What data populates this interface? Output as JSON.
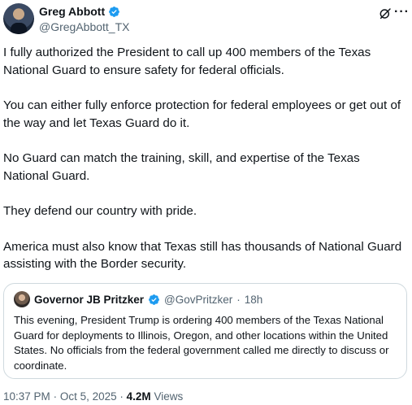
{
  "author": {
    "display_name": "Greg Abbott",
    "handle": "@GregAbbott_TX",
    "verified_icon": "verified-badge-icon"
  },
  "actions": {
    "grok_icon": "grok-icon",
    "more_label": "···"
  },
  "body": {
    "paragraphs": [
      "I fully authorized the President to call up 400 members of the Texas National Guard to ensure safety for federal officials.",
      "You can either fully enforce protection for federal employees or get out of the way and let Texas Guard do it.",
      "No Guard can match the training, skill, and expertise of the Texas National Guard.",
      "They defend our country with pride.",
      "America must also know that Texas still has thousands of National Guard assisting with the Border security."
    ]
  },
  "quote": {
    "display_name": "Governor JB Pritzker",
    "handle": "@GovPritzker",
    "separator": "·",
    "time": "18h",
    "text": "This evening, President Trump is ordering 400 members of the Texas National Guard for deployments to Illinois, Oregon, and other locations within the United States. No officials from the federal government called me directly to discuss or coordinate."
  },
  "meta": {
    "time": "10:37 PM",
    "separator": "·",
    "date": "Oct 5, 2025",
    "separator2": "·",
    "views_count": "4.2M",
    "views_label": "Views"
  },
  "colors": {
    "verified_blue": "#1d9bf0",
    "secondary_text": "#536471",
    "border": "#cfd9de"
  }
}
